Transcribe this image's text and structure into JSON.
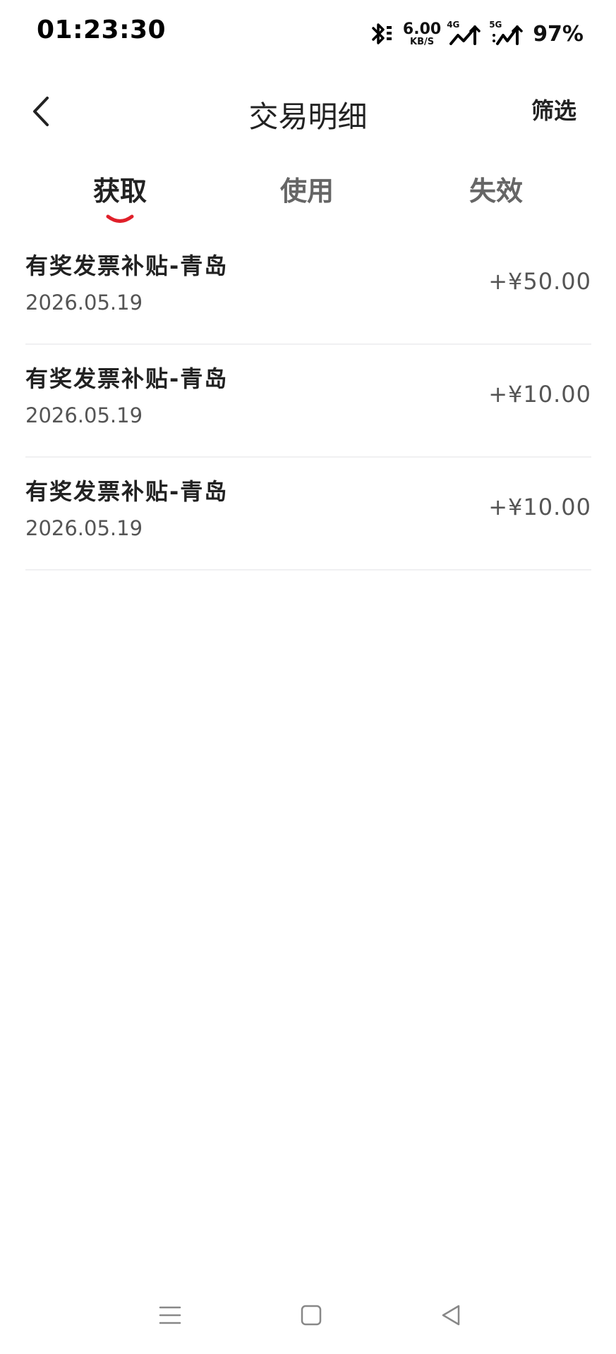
{
  "status_bar": {
    "time": "01:23:30",
    "net_speed": "6.00",
    "net_speed_unit": "KB/S",
    "signal_1_type": "4G",
    "signal_2_type": "5G",
    "battery": "97%"
  },
  "header": {
    "title": "交易明细",
    "filter_label": "筛选"
  },
  "tabs": [
    {
      "label": "获取",
      "active": true
    },
    {
      "label": "使用",
      "active": false
    },
    {
      "label": "失效",
      "active": false
    }
  ],
  "transactions": [
    {
      "title": "有奖发票补贴-青岛",
      "date": "2026.05.19",
      "amount": "+¥50.00"
    },
    {
      "title": "有奖发票补贴-青岛",
      "date": "2026.05.19",
      "amount": "+¥10.00"
    },
    {
      "title": "有奖发票补贴-青岛",
      "date": "2026.05.19",
      "amount": "+¥10.00"
    }
  ],
  "colors": {
    "accent": "#e0202a",
    "text_primary": "#222222",
    "text_secondary": "#555555",
    "divider": "#f0f0f2"
  },
  "icons": {
    "back": "chevron-left-icon",
    "bluetooth": "bluetooth-icon",
    "nav_menu": "menu-icon",
    "nav_home": "home-square-icon",
    "nav_back": "triangle-back-icon"
  }
}
